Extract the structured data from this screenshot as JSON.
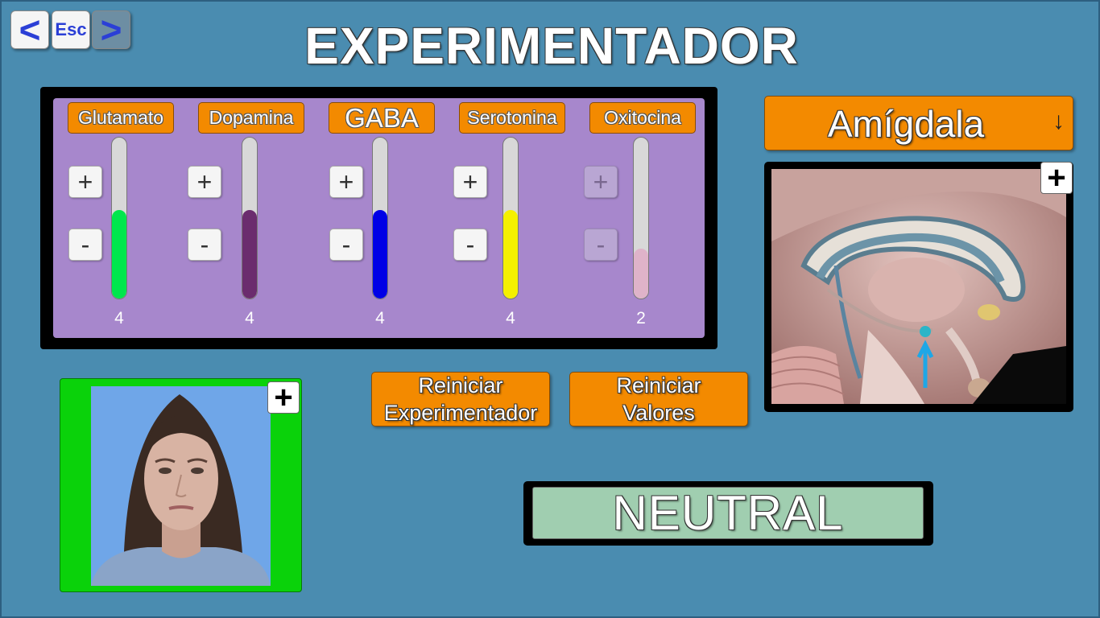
{
  "nav": {
    "back": "<",
    "esc": "Esc",
    "forward": ">"
  },
  "title": "EXPERIMENTADOR",
  "neurotransmitters": [
    {
      "label": "Glutamato",
      "value": "4",
      "level": 0.55,
      "color": "#00e64d",
      "enabled": true
    },
    {
      "label": "Dopamina",
      "value": "4",
      "level": 0.55,
      "color": "#6b2c6e",
      "enabled": true
    },
    {
      "label": "GABA",
      "value": "4",
      "level": 0.55,
      "color": "#0000e6",
      "enabled": true
    },
    {
      "label": "Serotonina",
      "value": "4",
      "level": 0.55,
      "color": "#f5f000",
      "enabled": true
    },
    {
      "label": "Oxitocina",
      "value": "2",
      "level": 0.31,
      "color": "#dfb3c9",
      "enabled": false
    }
  ],
  "controls": {
    "plus": "+",
    "minus": "-"
  },
  "region": {
    "selected": "Amígdala",
    "arrow": "↓"
  },
  "zoom": "+",
  "actions": {
    "reset_experimenter": "Reiniciar\nExperimentador",
    "reset_values": "Reiniciar\nValores"
  },
  "emotion": "NEUTRAL",
  "colors": {
    "background": "#4a8cb0",
    "panel": "#a787cc",
    "accent": "#f38a00",
    "face_frame": "#0ad20a",
    "emotion_box": "#a0ceb0"
  }
}
